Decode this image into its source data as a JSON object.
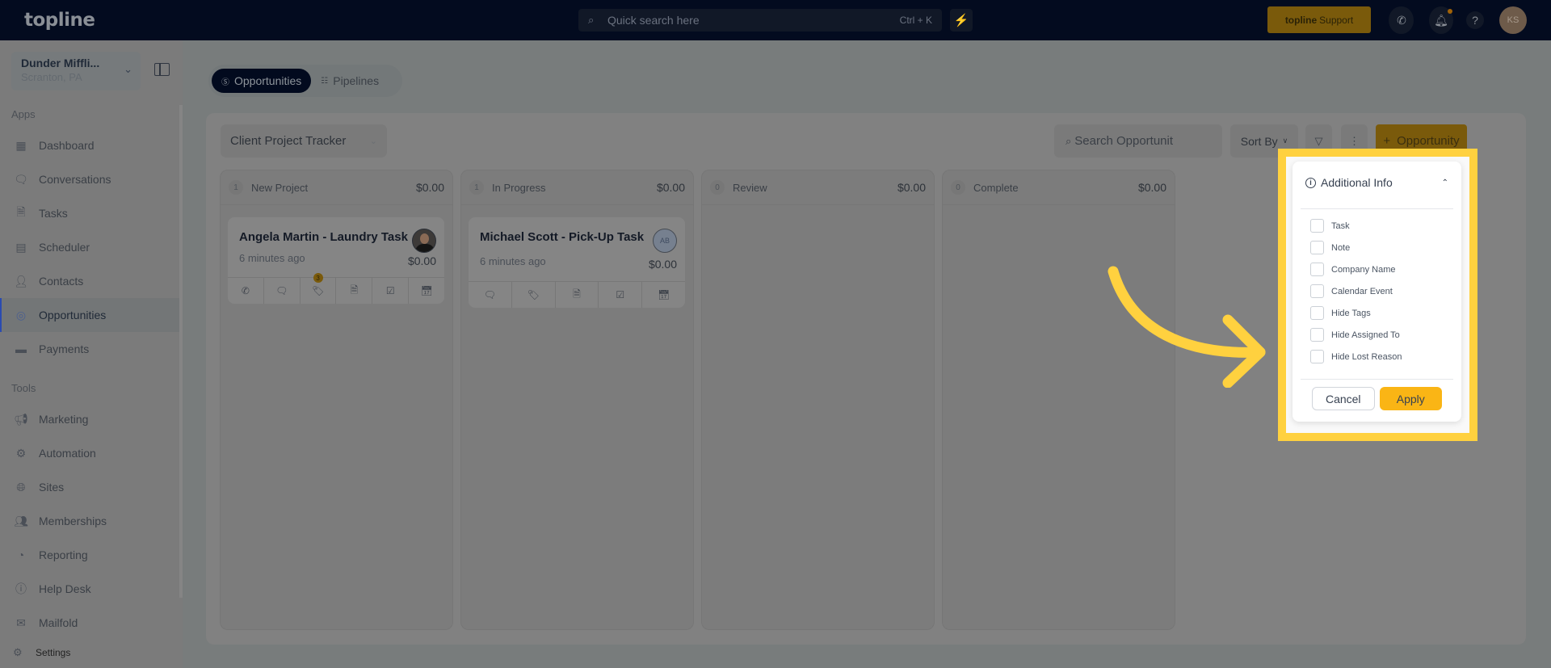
{
  "topbar": {
    "logo": "topline",
    "search_placeholder": "Quick search here",
    "search_shortcut": "Ctrl + K",
    "support_brand": "topline",
    "support_label": "Support",
    "avatar_initials": "KS"
  },
  "sidebar": {
    "location_name": "Dunder Miffli...",
    "location_sub": "Scranton, PA",
    "apps_label": "Apps",
    "tools_label": "Tools",
    "apps": [
      {
        "label": "Dashboard",
        "icon": "dashboard-icon"
      },
      {
        "label": "Conversations",
        "icon": "chat-bubbles-icon"
      },
      {
        "label": "Tasks",
        "icon": "task-document-icon"
      },
      {
        "label": "Scheduler",
        "icon": "calendar-icon"
      },
      {
        "label": "Contacts",
        "icon": "person-icon"
      },
      {
        "label": "Opportunities",
        "icon": "target-icon",
        "active": true
      },
      {
        "label": "Payments",
        "icon": "credit-card-icon"
      }
    ],
    "tools": [
      {
        "label": "Marketing",
        "icon": "megaphone-icon"
      },
      {
        "label": "Automation",
        "icon": "gears-icon"
      },
      {
        "label": "Sites",
        "icon": "globe-cursor-icon"
      },
      {
        "label": "Memberships",
        "icon": "users-add-icon"
      },
      {
        "label": "Reporting",
        "icon": "pie-chart-icon"
      },
      {
        "label": "Help Desk",
        "icon": "help-circle-icon"
      },
      {
        "label": "Mailfold",
        "icon": "mail-stack-icon"
      }
    ],
    "settings_label": "Settings"
  },
  "main": {
    "tabs": [
      {
        "label": "Opportunities",
        "active": true
      },
      {
        "label": "Pipelines",
        "active": false
      }
    ],
    "pipeline": "Client Project Tracker",
    "search_placeholder": "Search Opportunit",
    "sort_label": "Sort By",
    "add_label": "Opportunity",
    "columns": [
      {
        "name": "New Project",
        "count": "1",
        "total": "$0.00"
      },
      {
        "name": "In Progress",
        "count": "1",
        "total": "$0.00"
      },
      {
        "name": "Review",
        "count": "0",
        "total": "$0.00"
      },
      {
        "name": "Complete",
        "count": "0",
        "total": "$0.00"
      }
    ],
    "cards": [
      {
        "title": "Angela Martin - Laundry Task",
        "time": "6 minutes ago",
        "amount": "$0.00",
        "avatar": "photo",
        "tag_badge": "3"
      },
      {
        "title": "Michael Scott - Pick-Up Task",
        "time": "6 minutes ago",
        "amount": "$0.00",
        "avatar_initials": "AB"
      }
    ]
  },
  "popup": {
    "title": "Additional Info",
    "options": [
      "Task",
      "Note",
      "Company Name",
      "Calendar Event",
      "Hide Tags",
      "Hide Assigned To",
      "Hide Lost Reason"
    ],
    "cancel_label": "Cancel",
    "apply_label": "Apply"
  },
  "colors": {
    "highlight": "#ffd13f",
    "apply": "#fab515",
    "topbar": "#030b1f"
  }
}
